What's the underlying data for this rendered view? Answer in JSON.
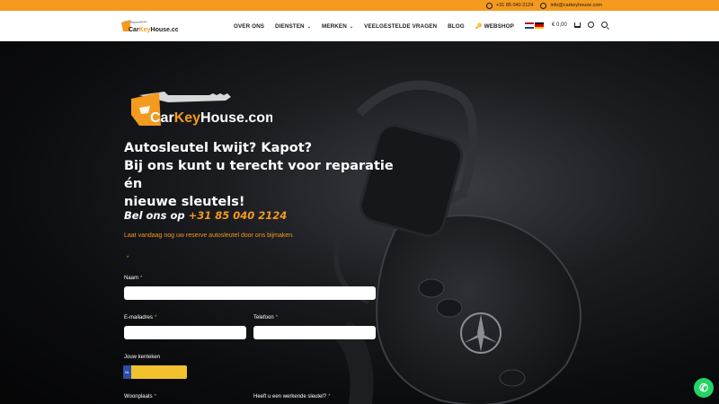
{
  "topbar": {
    "phone": "+31 85 040 2124",
    "email": "info@carkeyhouse.com"
  },
  "brand": {
    "name": "CarKeyHouse.com",
    "name_part1": "Car",
    "name_part2": "Key",
    "name_part3": "House.com",
    "accent": "#f39a1f"
  },
  "nav": {
    "items": [
      {
        "label": "OVER ONS",
        "dropdown": false
      },
      {
        "label": "DIENSTEN",
        "dropdown": true
      },
      {
        "label": "MERKEN",
        "dropdown": true
      },
      {
        "label": "VEELGESTELDE VRAGEN",
        "dropdown": false
      },
      {
        "label": "BLOG",
        "dropdown": false
      },
      {
        "label": "WEBSHOP",
        "dropdown": false
      }
    ],
    "cart_total": "€ 0,00"
  },
  "hero": {
    "headline_1": "Autosleutel kwijt? Kapot?",
    "headline_2": "Bij ons kunt u terecht voor reparatie én",
    "headline_3": "nieuwe sleutels!",
    "call_prefix": "Bel ons op",
    "call_number": "+31 85 040 2124",
    "subtitle": "Laat vandaag nog uw reserve autosleutel door ons bijmaken."
  },
  "form": {
    "required_mark": "*",
    "naam_label": "Naam",
    "email_label": "E-mailadres",
    "telefoon_label": "Telefoon",
    "kenteken_label": "Jouw kenteken",
    "plate_country": "NL",
    "woonplaats_label": "Woonplaats",
    "werkende_sleutel_label": "Heeft u een werkende sleutel?"
  }
}
